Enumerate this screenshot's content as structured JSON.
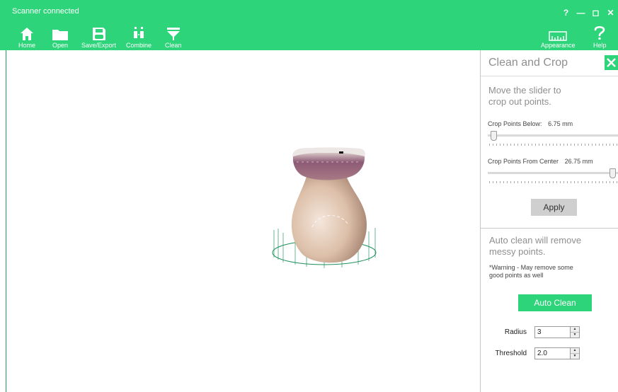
{
  "status_text": "Scanner connected",
  "window_controls": {
    "help": "?",
    "minimize": "—",
    "maximize": "◻",
    "close": "✕"
  },
  "toolbar": {
    "home": "Home",
    "open": "Open",
    "save_export": "Save/Export",
    "combine": "Combine",
    "clean": "Clean",
    "appearance": "Appearance",
    "help": "Help"
  },
  "panel": {
    "title": "Clean and Crop",
    "crop_hint": "Move the slider to crop out points.",
    "crop_below_label": "Crop Points Below:",
    "crop_below_value": "6.75 mm",
    "crop_below_fraction": 0.02,
    "crop_center_label": "Crop Points From Center",
    "crop_center_value": "26.75 mm",
    "crop_center_fraction": 0.98,
    "apply_label": "Apply",
    "auto_hint": "Auto clean will remove messy points.",
    "warning": "*Warning - May remove some good points as well",
    "auto_clean_label": "Auto Clean",
    "radius_label": "Radius",
    "radius_value": "3",
    "threshold_label": "Threshold",
    "threshold_value": "2.0"
  },
  "colors": {
    "accent": "#2ed47a",
    "model_body": "#dcbfa8",
    "model_rim": "#8d5a75",
    "crop_ring": "#1d8f5a"
  },
  "icons": [
    "home-icon",
    "folder-icon",
    "save-icon",
    "combine-icon",
    "clean-funnel-icon",
    "ruler-icon",
    "help-icon",
    "close-icon"
  ]
}
